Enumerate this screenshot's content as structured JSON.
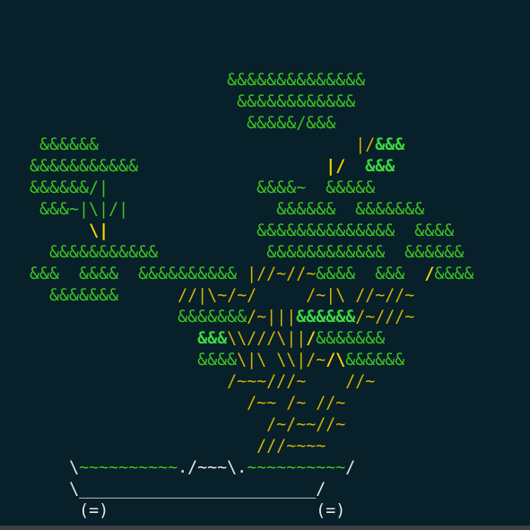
{
  "art": {
    "colors": {
      "g": "#3fc31f",
      "G": "#3fd63f",
      "y": "#d7b400",
      "Y": "#ffd700",
      "w": "#e8e8e8",
      "o": "#c9a400"
    },
    "lines": [
      [
        [
          " ",
          "g"
        ],
        [
          "&&&&&&&&&&&&&&",
          "g"
        ]
      ],
      [
        [
          " ",
          "g"
        ],
        [
          "&&&&&&&&&&&&",
          "g"
        ]
      ],
      [
        [
          " ",
          "g"
        ],
        [
          "&&&&&/&&&",
          "g"
        ]
      ],
      [
        [
          "    &&&&&&",
          "g"
        ],
        [
          "                          ",
          "g"
        ],
        [
          "|/",
          "y"
        ],
        [
          "&&&",
          "G"
        ]
      ],
      [
        [
          "   &&&&&&&&&&&",
          "g"
        ],
        [
          "                   ",
          "g"
        ],
        [
          "|/",
          "Y"
        ],
        [
          "  ",
          "g"
        ],
        [
          "&&&",
          "G"
        ]
      ],
      [
        [
          "   &&&&&&/|",
          "g"
        ],
        [
          "               ",
          "g"
        ],
        [
          "&&&&~",
          "g"
        ],
        [
          "  ",
          "g"
        ],
        [
          "&&&&&",
          "g"
        ]
      ],
      [
        [
          "    &&&~|\\|/|",
          "g"
        ],
        [
          "               ",
          "g"
        ],
        [
          "&&&&&&",
          "g"
        ],
        [
          "  ",
          "g"
        ],
        [
          "&&&&&&&",
          "g"
        ]
      ],
      [
        [
          "         ",
          "g"
        ],
        [
          "\\|",
          "Y"
        ],
        [
          "               ",
          "g"
        ],
        [
          "&&&&&&&&&&&&&&",
          "g"
        ],
        [
          "  ",
          "g"
        ],
        [
          "&&&&",
          "g"
        ]
      ],
      [
        [
          "     &&&&&&&&&&&",
          "g"
        ],
        [
          "           ",
          "g"
        ],
        [
          "&&&&&&&&&&&&",
          "g"
        ],
        [
          "  ",
          "g"
        ],
        [
          "&&&&&&",
          "g"
        ]
      ],
      [
        [
          " &&&  &&&&  &&&&&&&&&&",
          "g"
        ],
        [
          " |//~//~",
          "y"
        ],
        [
          "&&&&",
          "g"
        ],
        [
          "  ",
          "g"
        ],
        [
          "&&&",
          "g"
        ],
        [
          "  ",
          "g"
        ],
        [
          "/",
          "Y"
        ],
        [
          "&&&&",
          "g"
        ]
      ],
      [
        [
          "  &&&&&&&",
          "g"
        ],
        [
          "      ",
          "g"
        ],
        [
          "//|\\~/~/",
          "y"
        ],
        [
          "     ",
          "g"
        ],
        [
          "/~|\\ //~//~",
          "y"
        ]
      ],
      [
        [
          "        ",
          "g"
        ],
        [
          "&&&&&&&",
          "g"
        ],
        [
          "/~|||",
          "y"
        ],
        [
          "&&&&&&",
          "G"
        ],
        [
          "/~///~",
          "y"
        ]
      ],
      [
        [
          "         ",
          "g"
        ],
        [
          "&&&",
          "G"
        ],
        [
          "\\\\///\\||",
          "y"
        ],
        [
          "/",
          "Y"
        ],
        [
          "&&&&&&&",
          "g"
        ]
      ],
      [
        [
          "         ",
          "g"
        ],
        [
          "&&&&",
          "g"
        ],
        [
          "\\|\\ \\\\|/~",
          "y"
        ],
        [
          "/\\",
          "Y"
        ],
        [
          "&&&&&&",
          "g"
        ]
      ],
      [
        [
          "          ",
          "g"
        ],
        [
          "/~~~///~",
          "y"
        ],
        [
          "    ",
          "g"
        ],
        [
          "//~",
          "y"
        ]
      ],
      [
        [
          "           ",
          "g"
        ],
        [
          "/~~ /~ //~",
          "y"
        ]
      ],
      [
        [
          "            ",
          "g"
        ],
        [
          "/~/~~//~",
          "y"
        ]
      ],
      [
        [
          "           ",
          "g"
        ],
        [
          "///~~~~",
          "y"
        ]
      ],
      [
        [
          "      ",
          "g"
        ],
        [
          "\\",
          "w"
        ],
        [
          "~~~~~~~~~~",
          "g"
        ],
        [
          "./~~~\\.",
          "w"
        ],
        [
          "~~~~~~~~~~",
          "g"
        ],
        [
          "/",
          "w"
        ]
      ],
      [
        [
          "      ",
          "g"
        ],
        [
          "\\________________________/",
          "w"
        ]
      ],
      [
        [
          "      ",
          "g"
        ],
        [
          "(=)",
          "w"
        ],
        [
          "                     ",
          "g"
        ],
        [
          "(=)",
          "w"
        ]
      ]
    ]
  }
}
